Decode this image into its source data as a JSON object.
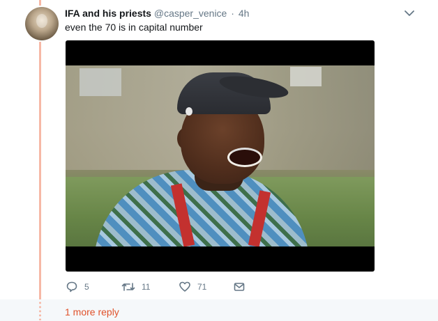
{
  "tweet": {
    "author_name": "IFA and his priests",
    "author_handle": "@casper_venice",
    "separator": "·",
    "time": "4h",
    "text": "even the 70 is in capital number",
    "actions": {
      "reply_count": "5",
      "retweet_count": "11",
      "like_count": "71"
    }
  },
  "thread": {
    "more_replies_label": "1 more reply"
  },
  "colors": {
    "accent": "#e0522b",
    "thread_line": "#f6b8a6",
    "secondary_text": "#657786"
  },
  "icons": {
    "caret": "chevron-down-icon",
    "reply": "reply-icon",
    "retweet": "retweet-icon",
    "like": "heart-icon",
    "dm": "envelope-icon"
  }
}
